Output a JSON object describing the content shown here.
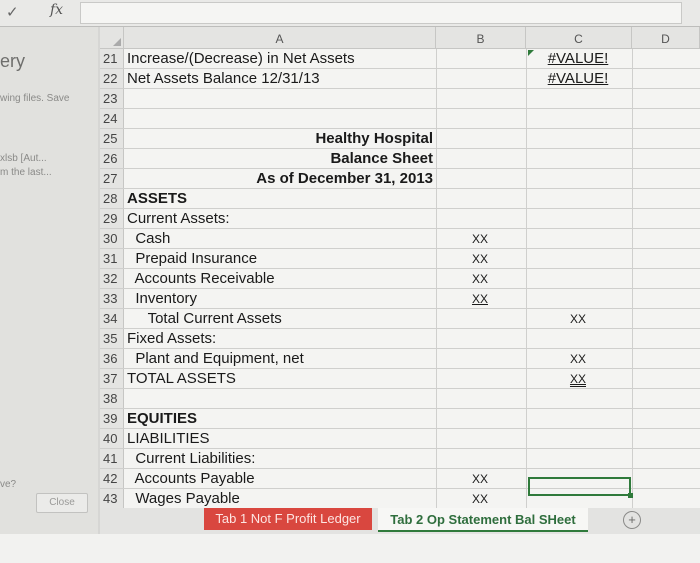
{
  "formula_bar": {
    "check_icon": "check-icon",
    "fx_label": "fx",
    "value": ""
  },
  "background_window": {
    "title_fragment": "ery",
    "line1": "wing files. Save",
    "line2": "xlsb [Aut...",
    "line3": "m the last...",
    "line4": "ve?",
    "close_label": "Close"
  },
  "columns": [
    "A",
    "B",
    "C",
    "D"
  ],
  "rows": [
    {
      "n": "21",
      "a": "Increase/(Decrease) in Net Assets",
      "b": "",
      "c": "#VALUE!"
    },
    {
      "n": "22",
      "a": "Net Assets Balance 12/31/13",
      "b": "",
      "c": "#VALUE!"
    },
    {
      "n": "23",
      "a": "",
      "b": "",
      "c": ""
    },
    {
      "n": "24",
      "a": "",
      "b": "",
      "c": ""
    },
    {
      "n": "25",
      "a": "Healthy Hospital",
      "b": "",
      "c": ""
    },
    {
      "n": "26",
      "a": "Balance Sheet",
      "b": "",
      "c": ""
    },
    {
      "n": "27",
      "a": "As of December 31, 2013",
      "b": "",
      "c": ""
    },
    {
      "n": "28",
      "a": "ASSETS",
      "b": "",
      "c": ""
    },
    {
      "n": "29",
      "a": "Current Assets:",
      "b": "",
      "c": ""
    },
    {
      "n": "30",
      "a": "  Cash",
      "b": "XX",
      "c": ""
    },
    {
      "n": "31",
      "a": "  Prepaid Insurance",
      "b": "XX",
      "c": ""
    },
    {
      "n": "32",
      "a": "  Accounts Receivable",
      "b": "XX",
      "c": ""
    },
    {
      "n": "33",
      "a": "  Inventory",
      "b": "XX",
      "c": ""
    },
    {
      "n": "34",
      "a": "     Total Current Assets",
      "b": "",
      "c": "XX"
    },
    {
      "n": "35",
      "a": "Fixed Assets:",
      "b": "",
      "c": ""
    },
    {
      "n": "36",
      "a": "  Plant and Equipment, net",
      "b": "",
      "c": "XX"
    },
    {
      "n": "37",
      "a": "TOTAL ASSETS",
      "b": "",
      "c": "XX"
    },
    {
      "n": "38",
      "a": "",
      "b": "",
      "c": ""
    },
    {
      "n": "39",
      "a": "EQUITIES",
      "b": "",
      "c": ""
    },
    {
      "n": "40",
      "a": "LIABILITIES",
      "b": "",
      "c": ""
    },
    {
      "n": "41",
      "a": "  Current Liabilities:",
      "b": "",
      "c": ""
    },
    {
      "n": "42",
      "a": "  Accounts Payable",
      "b": "XX",
      "c": ""
    },
    {
      "n": "43",
      "a": "  Wages Payable",
      "b": "XX",
      "c": ""
    }
  ],
  "tabs": [
    {
      "label": "Tab 1 Not F Profit Ledger",
      "color": "#d9473f"
    },
    {
      "label": "Tab 2 Op Statement Bal SHeet",
      "color": "#2f7a3b",
      "active": true
    }
  ],
  "add_sheet_icon": "plus-circle-icon",
  "cursor_icon": "move-cursor-icon"
}
